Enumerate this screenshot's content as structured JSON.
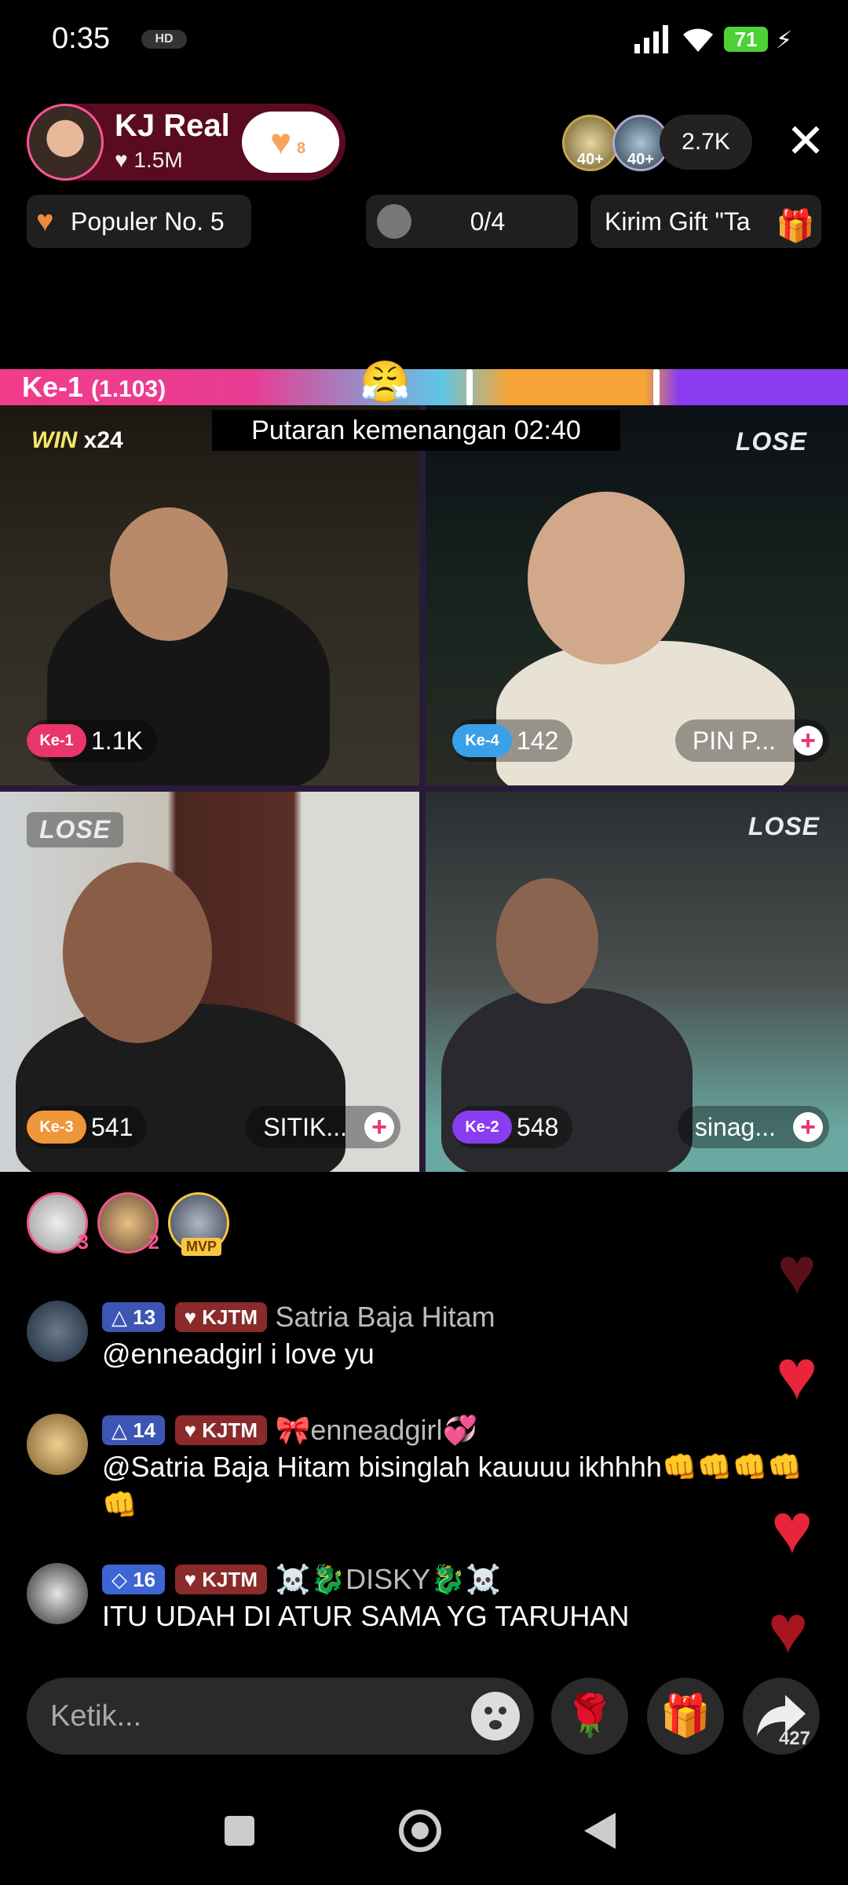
{
  "status_bar": {
    "time": "0:35",
    "hd_badge": "HD",
    "battery": "71"
  },
  "host": {
    "name": "KJ Real",
    "likes": "♥ 1.5M",
    "follow_count": "8"
  },
  "viewers": {
    "badges": [
      "40+",
      "40+"
    ],
    "count": "2.7K"
  },
  "pills": {
    "populer": "Populer No. 5",
    "task": "0/4",
    "gift": "Kirim Gift \"Ta"
  },
  "battle": {
    "round_label": "Ke-1",
    "score": "(1.103)",
    "round_text": "Putaran kemenangan   02:40"
  },
  "tiles": [
    {
      "badge_win": "WIN",
      "win_mult": "x",
      "win_count": "24",
      "rank": "Ke-1",
      "score": "1.1K",
      "rank_color": "#e8356a"
    },
    {
      "lose": "LOSE",
      "rank": "Ke-4",
      "score": "142",
      "name": "PIN P...",
      "rank_color": "#3aa0e8"
    },
    {
      "lose": "LOSE",
      "rank": "Ke-3",
      "score": "541",
      "name": "SITIK...",
      "rank_color": "#f0963a"
    },
    {
      "lose": "LOSE",
      "rank": "Ke-2",
      "score": "548",
      "name": "sinag...",
      "rank_color": "#8a3cf0"
    }
  ],
  "gifters": [
    {
      "n": "3"
    },
    {
      "n": "2"
    },
    {
      "badge": "MVP"
    }
  ],
  "chat": [
    {
      "level": "13",
      "fan": "KJTM",
      "user": "Satria Baja Hitam",
      "text": "@enneadgirl i love yu"
    },
    {
      "level": "14",
      "fan": "KJTM",
      "user": "🎀enneadgirl💞",
      "text": "@Satria Baja Hitam bisinglah kauuuu ikhhhh👊👊👊👊👊"
    },
    {
      "level": "16",
      "fan": "KJTM",
      "user": "☠️🐉DISKY🐉☠️",
      "text": "ITU UDAH DI ATUR SAMA YG TARUHAN"
    }
  ],
  "input": {
    "placeholder": "Ketik..."
  },
  "share": {
    "count": "427"
  },
  "icons": {
    "close": "close-icon",
    "heart": "heart-icon",
    "gift": "gift-icon",
    "rose": "rose-icon",
    "share": "share-icon",
    "emoji": "emoji-icon"
  },
  "colors": {
    "accent_pink": "#e8356a",
    "host_pill": "#5a0b1f",
    "like_heart": "#e8253a"
  }
}
